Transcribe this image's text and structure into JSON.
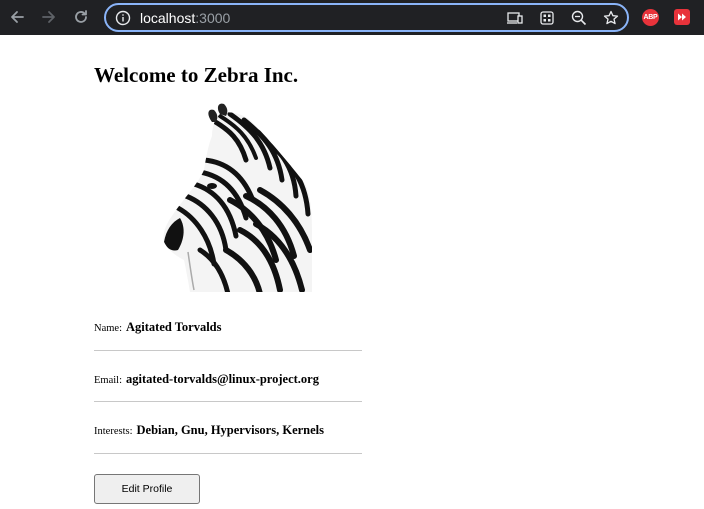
{
  "browser": {
    "url_host": "localhost",
    "url_port": ":3000",
    "extensions": [
      {
        "name": "adblock-plus",
        "label": "ABP",
        "color": "#e8333b"
      },
      {
        "name": "red-extension",
        "color": "#e8333b"
      }
    ],
    "accent_color": "#8ab4f8"
  },
  "page": {
    "title": "Welcome to Zebra Inc.",
    "image_subject": "zebra",
    "fields": [
      {
        "label": "Name:",
        "value": "Agitated Torvalds"
      },
      {
        "label": "Email:",
        "value": "agitated-torvalds@linux-project.org"
      },
      {
        "label": "Interests:",
        "value": "Debian, Gnu, Hypervisors, Kernels"
      }
    ],
    "edit_button": "Edit Profile"
  }
}
